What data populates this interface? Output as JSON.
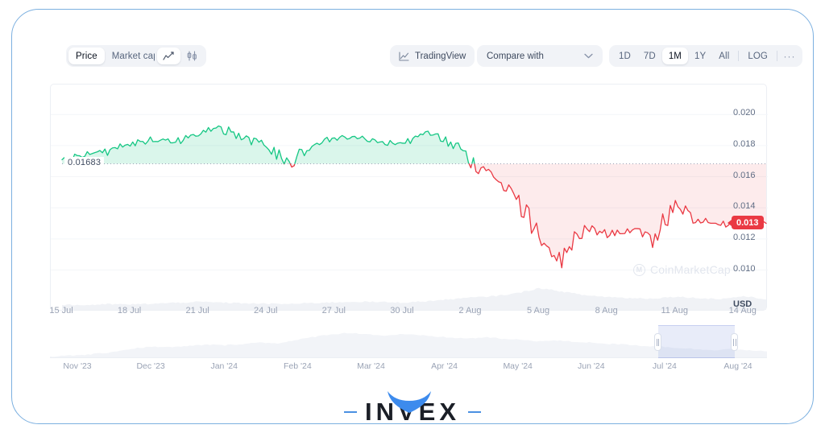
{
  "toolbar": {
    "price_market_group": [
      {
        "label": "Price",
        "active": true
      },
      {
        "label": "Market cap",
        "active": false
      }
    ],
    "chart_type_group": [
      {
        "icon": "line-chart-icon",
        "active": true
      },
      {
        "icon": "candlestick-chart-icon",
        "active": false
      }
    ],
    "tradingview_label": "TradingView",
    "tradingview_icon": "tradingview-icon",
    "compare_label": "Compare with",
    "compare_caret_icon": "chevron-down-icon",
    "range_group": [
      {
        "label": "1D",
        "active": false
      },
      {
        "label": "7D",
        "active": false
      },
      {
        "label": "1M",
        "active": true
      },
      {
        "label": "1Y",
        "active": false
      },
      {
        "label": "All",
        "active": false
      }
    ],
    "log_label": "LOG",
    "more_label": "···"
  },
  "chart_meta": {
    "baseline_label": "0.01683",
    "current_price_badge": "0.013",
    "unit_label": "USD",
    "watermark_text": "CoinMarketCap",
    "watermark_mark": "M",
    "line_up_color": "#16c784",
    "line_down_color": "#ea3943",
    "fill_up_color": "rgba(22,199,132,0.16)",
    "fill_down_color": "rgba(234,57,67,0.10)",
    "badge_color": "#ea3943",
    "frame_color": "#7cb0e0",
    "accent_color": "#4a90e2"
  },
  "footer": {
    "brand": "INVEX"
  },
  "chart_data": {
    "type": "area",
    "title": "",
    "subtitle": "",
    "xlabel": "",
    "ylabel": "USD",
    "ylim": [
      0.0092,
      0.0212
    ],
    "yticks": [
      0.02,
      0.018,
      0.016,
      0.014,
      0.013,
      0.012,
      0.01
    ],
    "ytick_labels": [
      "0.020",
      "0.018",
      "0.016",
      "0.014",
      "0.013",
      "0.012",
      "0.010"
    ],
    "grid": true,
    "legend": "none",
    "baseline_value": 0.01683,
    "current_value": 0.013,
    "xtick_labels": [
      "15 Jul",
      "18 Jul",
      "21 Jul",
      "24 Jul",
      "27 Jul",
      "30 Jul",
      "2 Aug",
      "5 Aug",
      "8 Aug",
      "11 Aug",
      "14 Aug"
    ],
    "series": [
      {
        "name": "Price (USD)",
        "x": [
          "15 Jul",
          "16 Jul",
          "17 Jul",
          "18 Jul",
          "19 Jul",
          "20 Jul",
          "21 Jul",
          "22 Jul",
          "23 Jul",
          "24 Jul",
          "25 Jul",
          "26 Jul",
          "27 Jul",
          "28 Jul",
          "29 Jul",
          "30 Jul",
          "31 Jul",
          "1 Aug",
          "2 Aug",
          "3 Aug",
          "4 Aug",
          "5 Aug",
          "6 Aug",
          "7 Aug",
          "8 Aug",
          "9 Aug",
          "10 Aug",
          "11 Aug",
          "12 Aug",
          "13 Aug",
          "14 Aug",
          "15 Aug"
        ],
        "values": [
          0.0169,
          0.01745,
          0.01762,
          0.0181,
          0.0184,
          0.01826,
          0.0188,
          0.01912,
          0.0185,
          0.01792,
          0.0169,
          0.018,
          0.01845,
          0.01862,
          0.0182,
          0.01812,
          0.0188,
          0.01838,
          0.017,
          0.01585,
          0.0147,
          0.01185,
          0.0106,
          0.01275,
          0.0123,
          0.0126,
          0.01205,
          0.0143,
          0.0132,
          0.0129,
          0.01318,
          0.013
        ]
      }
    ],
    "volume": {
      "name": "Volume",
      "color": "#f0f2f6",
      "values": [
        0.22,
        0.2,
        0.24,
        0.23,
        0.26,
        0.3,
        0.34,
        0.31,
        0.28,
        0.26,
        0.25,
        0.29,
        0.32,
        0.35,
        0.33,
        0.31,
        0.36,
        0.44,
        0.52,
        0.58,
        0.7,
        0.92,
        0.78,
        0.62,
        0.55,
        0.5,
        0.48,
        0.56,
        0.5,
        0.46,
        0.58,
        0.44
      ]
    }
  },
  "navigator": {
    "type": "area",
    "xtick_labels": [
      "Nov '23",
      "Dec '23",
      "Jan '24",
      "Feb '24",
      "Mar '24",
      "Apr '24",
      "May '24",
      "Jun '24",
      "Jul '24",
      "Aug '24"
    ],
    "values": [
      0.05,
      0.07,
      0.1,
      0.14,
      0.22,
      0.3,
      0.34,
      0.32,
      0.36,
      0.4,
      0.38,
      0.42,
      0.46,
      0.44,
      0.52,
      0.62,
      0.7,
      0.74,
      0.72,
      0.66,
      0.7,
      0.68,
      0.64,
      0.6,
      0.58,
      0.62,
      0.56,
      0.54,
      0.5,
      0.52,
      0.48,
      0.46,
      0.42,
      0.4,
      0.36,
      0.34,
      0.3,
      0.26,
      0.24,
      0.28,
      0.22,
      0.2
    ],
    "selection": {
      "start_pct": 84.8,
      "end_pct": 95.5
    },
    "handle_icon": "drag-handle-icon"
  }
}
